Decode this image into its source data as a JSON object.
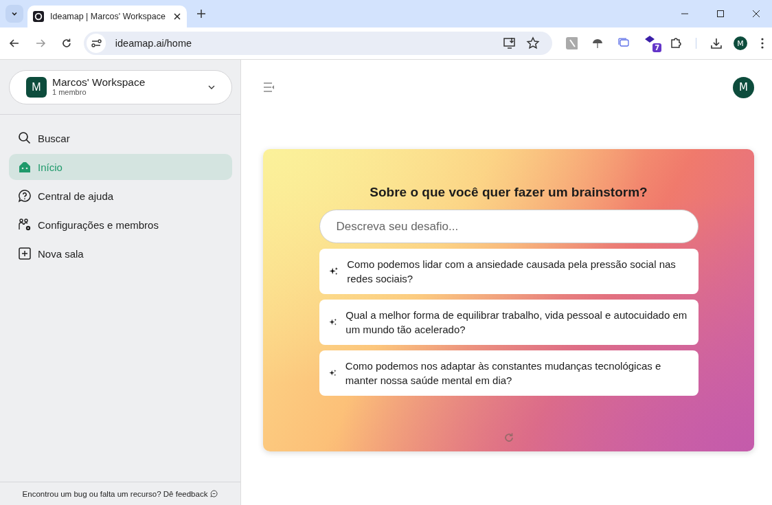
{
  "browser": {
    "tab_title": "Ideamap | Marcos' Workspace",
    "url": "ideamap.ai/home",
    "extension_badge": "7",
    "profile_initial": "M"
  },
  "workspace": {
    "initial": "M",
    "name": "Marcos' Workspace",
    "members": "1 membro"
  },
  "sidebar": {
    "items": [
      {
        "label": "Buscar",
        "kind": "search",
        "selected": false
      },
      {
        "label": "Início",
        "kind": "home",
        "selected": true
      },
      {
        "label": "Central de ajuda",
        "kind": "help",
        "selected": false
      },
      {
        "label": "Configurações e membros",
        "kind": "settings",
        "selected": false
      },
      {
        "label": "Nova sala",
        "kind": "add",
        "selected": false
      }
    ],
    "footer": "Encontrou um bug ou falta um recurso? Dê feedback"
  },
  "header": {
    "avatar_initial": "M"
  },
  "brainstorm": {
    "title": "Sobre o que você quer fazer um brainstorm?",
    "placeholder": "Descreva seu desafio...",
    "suggestions": [
      "Como podemos lidar com a ansiedade causada pela pressão social nas redes sociais?",
      "Qual a melhor forma de equilibrar trabalho, vida pessoal e autocuidado em um mundo tão acelerado?",
      "Como podemos nos adaptar às constantes mudanças tecnológicas e manter nossa saúde mental em dia?"
    ]
  }
}
